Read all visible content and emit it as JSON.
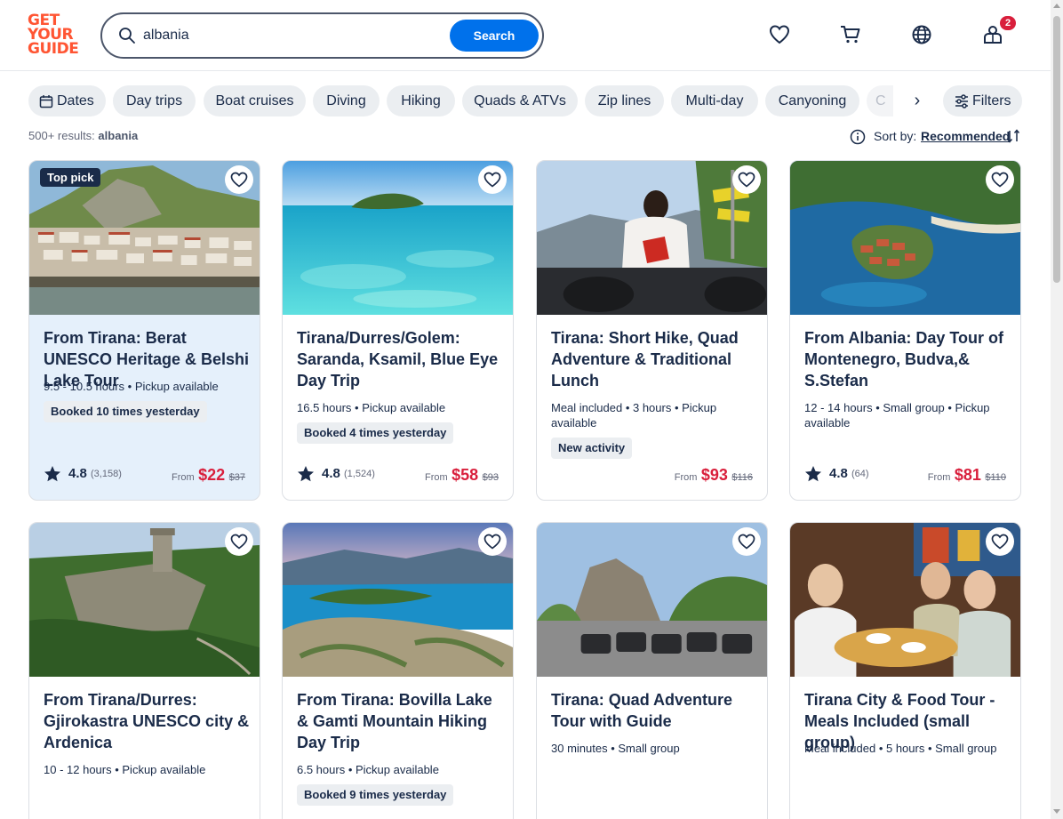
{
  "brand": {
    "logo_line1": "GET",
    "logo_line2": "YOUR",
    "logo_line3": "GUIDE",
    "logo_color": "#ff5533"
  },
  "search": {
    "value": "albania",
    "button_label": "Search"
  },
  "header": {
    "wishlist_icon": "heart-icon",
    "cart_icon": "cart-icon",
    "language_icon": "globe-icon",
    "profile_icon": "profile-icon",
    "notification_count": "2"
  },
  "chips": [
    {
      "label": "Dates",
      "icon": "calendar-icon"
    },
    {
      "label": "Day trips"
    },
    {
      "label": "Boat cruises"
    },
    {
      "label": "Diving"
    },
    {
      "label": "Hiking"
    },
    {
      "label": "Quads & ATVs"
    },
    {
      "label": "Zip lines"
    },
    {
      "label": "Multi-day"
    },
    {
      "label": "Canyoning"
    },
    {
      "label": "C"
    }
  ],
  "filters_label": "Filters",
  "results": {
    "count_text": "500+ results:",
    "query": "albania",
    "sort_label": "Sort by:",
    "sort_value": "Recommended"
  },
  "cards": [
    {
      "badge": "Top pick",
      "title": "From Tirana: Berat UNESCO Heritage & Belshi Lake Tour",
      "meta": "9.5 - 10.5 hours • Pickup available",
      "tag": "Booked 10 times yesterday",
      "rating": "4.8",
      "reviews": "(3,158)",
      "price_from": "From",
      "price": "$22",
      "old_price": "$37"
    },
    {
      "title": "Tirana/Durres/Golem: Saranda, Ksamil, Blue Eye Day Trip",
      "meta": "16.5 hours • Pickup available",
      "tag": "Booked 4 times yesterday",
      "rating": "4.8",
      "reviews": "(1,524)",
      "price_from": "From",
      "price": "$58",
      "old_price": "$93"
    },
    {
      "title": "Tirana: Short Hike, Quad Adventure & Traditional Lunch",
      "meta": "Meal included • 3 hours • Pickup available",
      "tag": "New activity",
      "price_from": "From",
      "price": "$93",
      "old_price": "$116"
    },
    {
      "title": "From Albania: Day Tour of Montenegro, Budva,& S.Stefan",
      "meta": "12 - 14 hours • Small group • Pickup available",
      "rating": "4.8",
      "reviews": "(64)",
      "price_from": "From",
      "price": "$81",
      "old_price": "$110"
    },
    {
      "title": "From Tirana/Durres: Gjirokastra UNESCO city & Ardenica",
      "meta": "10 - 12 hours • Pickup available"
    },
    {
      "title": "From Tirana: Bovilla Lake & Gamti Mountain Hiking Day Trip",
      "meta": "6.5 hours • Pickup available",
      "tag": "Booked 9 times yesterday"
    },
    {
      "title": "Tirana: Quad Adventure Tour with Guide",
      "meta": "30 minutes • Small group"
    },
    {
      "title": "Tirana City & Food Tour - Meals Included (small group)",
      "meta": "Meal included • 5 hours • Small group"
    }
  ],
  "colors": {
    "accent": "#0071eb",
    "price": "#d91f3c",
    "text": "#1a2b49",
    "highlight_card": "#e5f0fb"
  }
}
